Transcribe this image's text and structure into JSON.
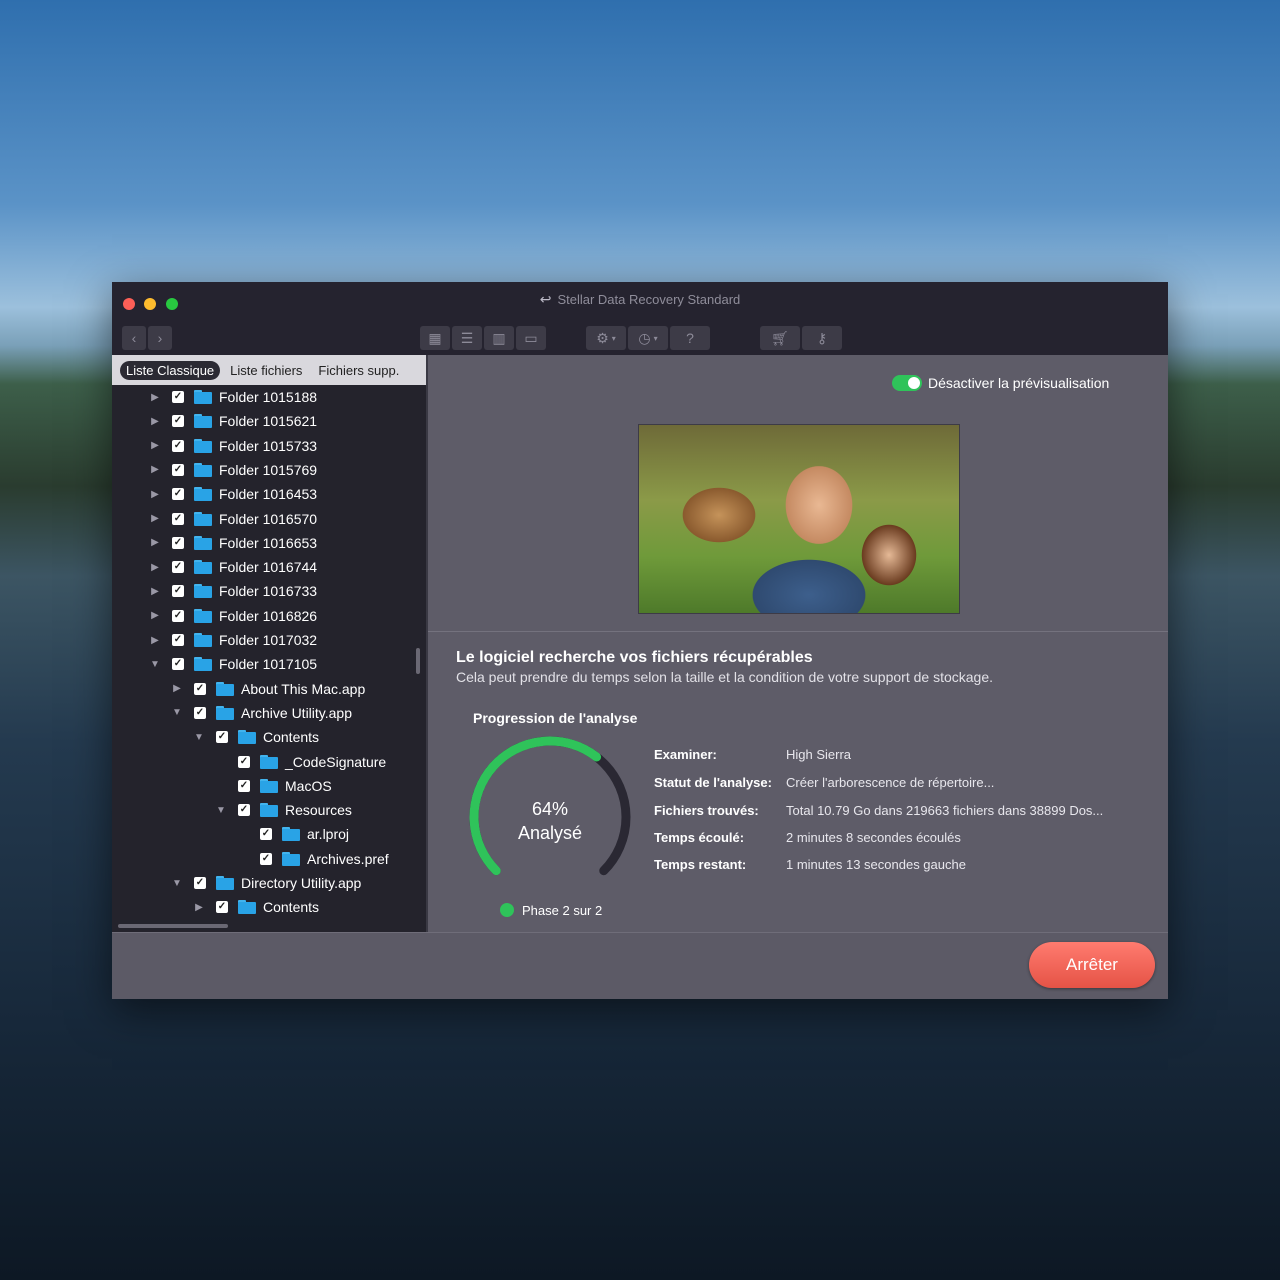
{
  "window": {
    "title": "Stellar Data Recovery Standard",
    "title_icon": "back-arrow-icon"
  },
  "toolbar": {
    "nav": [
      "chevron-left-icon",
      "chevron-right-icon"
    ],
    "views": [
      "grid-view-icon",
      "list-view-icon",
      "column-view-icon",
      "coverflow-view-icon"
    ],
    "tools": [
      "gear-icon",
      "history-icon",
      "help-icon"
    ],
    "help_label": "?",
    "store": [
      "cart-icon",
      "key-icon"
    ]
  },
  "tabs": [
    {
      "label": "Liste Classique",
      "active": true
    },
    {
      "label": "Liste fichiers",
      "active": false
    },
    {
      "label": "Fichiers supp.",
      "active": false
    }
  ],
  "tree": [
    {
      "label": "Folder 1015188",
      "level": 0,
      "expanded": false
    },
    {
      "label": "Folder 1015621",
      "level": 0,
      "expanded": false
    },
    {
      "label": "Folder 1015733",
      "level": 0,
      "expanded": false
    },
    {
      "label": "Folder 1015769",
      "level": 0,
      "expanded": false
    },
    {
      "label": "Folder 1016453",
      "level": 0,
      "expanded": false
    },
    {
      "label": "Folder 1016570",
      "level": 0,
      "expanded": false
    },
    {
      "label": "Folder 1016653",
      "level": 0,
      "expanded": false
    },
    {
      "label": "Folder 1016744",
      "level": 0,
      "expanded": false
    },
    {
      "label": "Folder 1016733",
      "level": 0,
      "expanded": false
    },
    {
      "label": "Folder 1016826",
      "level": 0,
      "expanded": false
    },
    {
      "label": "Folder 1017032",
      "level": 0,
      "expanded": false
    },
    {
      "label": "Folder 1017105",
      "level": 0,
      "expanded": true
    },
    {
      "label": "About This Mac.app",
      "level": 1,
      "expanded": false
    },
    {
      "label": "Archive Utility.app",
      "level": 1,
      "expanded": true
    },
    {
      "label": "Contents",
      "level": 2,
      "expanded": true
    },
    {
      "label": "_CodeSignature",
      "level": 3,
      "expanded": null
    },
    {
      "label": "MacOS",
      "level": 3,
      "expanded": null
    },
    {
      "label": "Resources",
      "level": 3,
      "expanded": true
    },
    {
      "label": "ar.lproj",
      "level": 4,
      "expanded": null
    },
    {
      "label": "Archives.pref",
      "level": 4,
      "expanded": null
    },
    {
      "label": "Directory Utility.app",
      "level": 1,
      "expanded": true
    },
    {
      "label": "Contents",
      "level": 2,
      "expanded": false
    }
  ],
  "preview": {
    "toggle_label": "Désactiver la prévisualisation",
    "toggle_on": true
  },
  "scan": {
    "heading": "Le logiciel recherche vos fichiers récupérables",
    "subheading": "Cela peut prendre du temps selon la taille et la condition de votre support de stockage.",
    "progress_title": "Progression de l'analyse",
    "percent_label": "64%",
    "percent_value": 0.64,
    "status_word": "Analysé",
    "phase_label": "Phase 2 sur 2",
    "details": [
      {
        "key": "Examiner:",
        "value": "High Sierra"
      },
      {
        "key": "Statut de l'analyse:",
        "value": "Créer l'arborescence de répertoire..."
      },
      {
        "key": "Fichiers trouvés:",
        "value": "Total 10.79 Go dans 219663 fichiers dans 38899 Dos..."
      },
      {
        "key": "Temps écoulé:",
        "value": "2 minutes 8 secondes écoulés"
      },
      {
        "key": "Temps restant:",
        "value": "1 minutes 13 secondes gauche"
      }
    ]
  },
  "actions": {
    "stop_label": "Arrêter"
  },
  "colors": {
    "accent_green": "#2fc35a",
    "stop_button": "#e55346",
    "folder_blue": "#29a3e6"
  }
}
